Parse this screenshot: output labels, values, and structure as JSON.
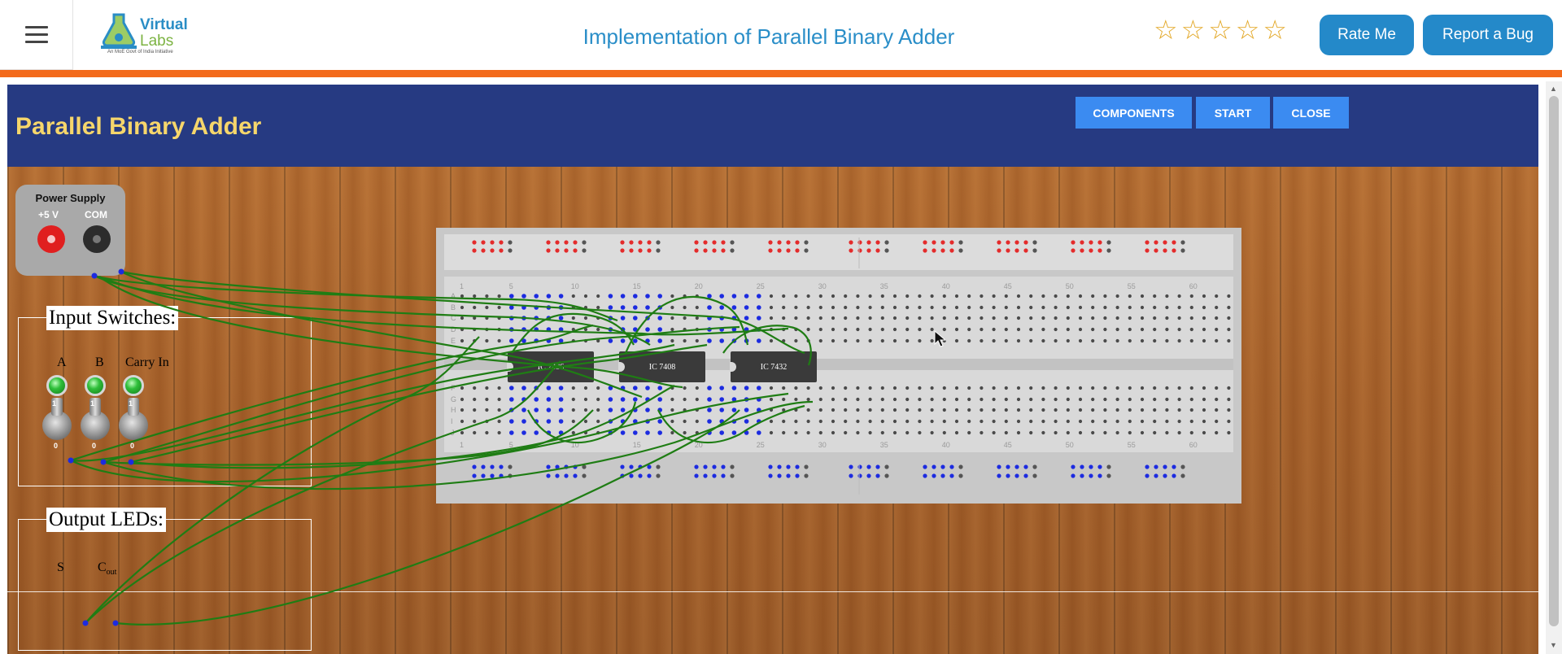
{
  "header": {
    "menu_icon": "hamburger-menu-icon",
    "logo": {
      "line1": "Virtual",
      "line2": "Labs",
      "tagline": "An MoE Govt of India Initiative"
    },
    "title": "Implementation of Parallel Binary Adder",
    "rating": {
      "max": 5,
      "filled": 0,
      "icon": "star-outline-icon"
    },
    "rate_button": "Rate Me",
    "bug_button": "Report a Bug",
    "accent_orange": "#f36a1c",
    "accent_blue": "#2489c9"
  },
  "simulator": {
    "title": "Parallel Binary Adder",
    "buttons": {
      "components": "COMPONENTS",
      "start": "START",
      "close": "CLOSE"
    },
    "power_supply": {
      "title": "Power Supply",
      "plus_label": "+5 V",
      "com_label": "COM"
    },
    "input_panel": {
      "title": "Input Switches:",
      "switches": [
        {
          "label": "A",
          "led": "on",
          "position": "1"
        },
        {
          "label": "B",
          "led": "on",
          "position": "1"
        },
        {
          "label": "Carry In",
          "led": "on",
          "position": "1"
        }
      ],
      "on_mark": "1",
      "off_mark": "0"
    },
    "output_panel": {
      "title": "Output LEDs:",
      "sum_label": "S",
      "cout_label": "C",
      "cout_sub": "out"
    },
    "breadboard": {
      "chips": [
        "IC 7486",
        "IC 7408",
        "IC 7432"
      ],
      "column_numbers": [
        "1",
        "5",
        "10",
        "15",
        "20",
        "25",
        "30",
        "35",
        "40",
        "45",
        "50",
        "55",
        "60"
      ],
      "row_letters_top": [
        "A",
        "B",
        "C",
        "D",
        "E"
      ],
      "row_letters_bottom": [
        "F",
        "G",
        "H",
        "I",
        "J"
      ]
    },
    "wire_color": "#1f7d14"
  }
}
